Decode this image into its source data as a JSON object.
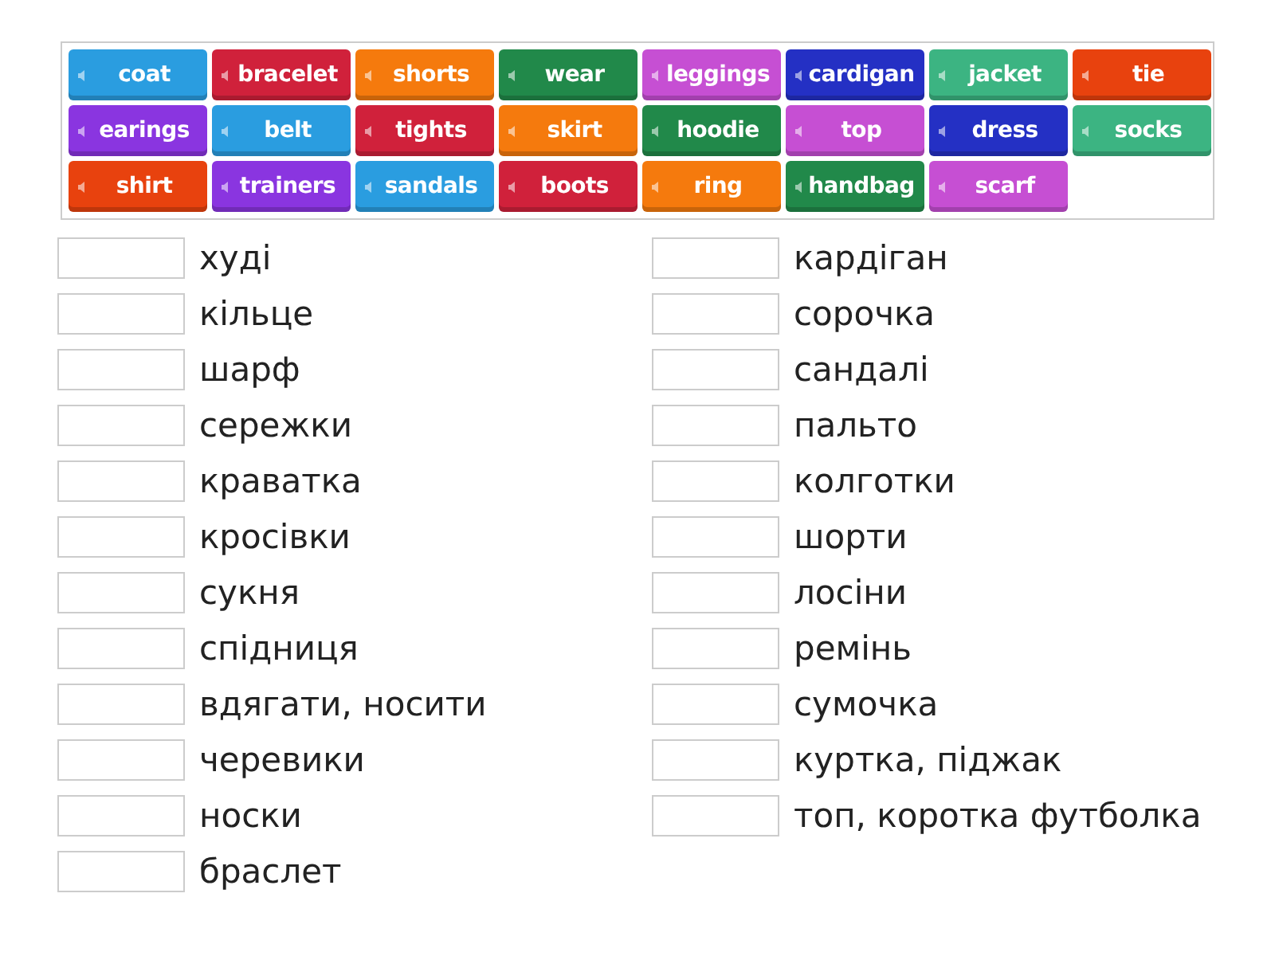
{
  "tiles": [
    {
      "word": "coat",
      "color": "#2a9de0"
    },
    {
      "word": "bracelet",
      "color": "#d0213b"
    },
    {
      "word": "shorts",
      "color": "#f57a0d"
    },
    {
      "word": "wear",
      "color": "#21894a"
    },
    {
      "word": "leggings",
      "color": "#c64fd3"
    },
    {
      "word": "cardigan",
      "color": "#2430c4"
    },
    {
      "word": "jacket",
      "color": "#3cb482"
    },
    {
      "word": "tie",
      "color": "#e8420e"
    },
    {
      "word": "earings",
      "color": "#8a35e0"
    },
    {
      "word": "belt",
      "color": "#2a9de0"
    },
    {
      "word": "tights",
      "color": "#d0213b"
    },
    {
      "word": "skirt",
      "color": "#f57a0d"
    },
    {
      "word": "hoodie",
      "color": "#21894a"
    },
    {
      "word": "top",
      "color": "#c64fd3"
    },
    {
      "word": "dress",
      "color": "#2430c4"
    },
    {
      "word": "socks",
      "color": "#3cb482"
    },
    {
      "word": "shirt",
      "color": "#e8420e"
    },
    {
      "word": "trainers",
      "color": "#8a35e0"
    },
    {
      "word": "sandals",
      "color": "#2a9de0"
    },
    {
      "word": "boots",
      "color": "#d0213b"
    },
    {
      "word": "ring",
      "color": "#f57a0d"
    },
    {
      "word": "handbag",
      "color": "#21894a"
    },
    {
      "word": "scarf",
      "color": "#c64fd3"
    }
  ],
  "columns": [
    [
      "худі",
      "кільце",
      "шарф",
      "сережки",
      "краватка",
      "кросівки",
      "сукня",
      "спідниця",
      "вдягати, носити",
      "черевики",
      "носки",
      "браслет"
    ],
    [
      "кардіган",
      "сорочка",
      "сандалі",
      "пальто",
      "колготки",
      "шорти",
      "лосіни",
      "ремінь",
      "сумочка",
      "куртка, піджак",
      "топ, коротка футболка"
    ]
  ]
}
